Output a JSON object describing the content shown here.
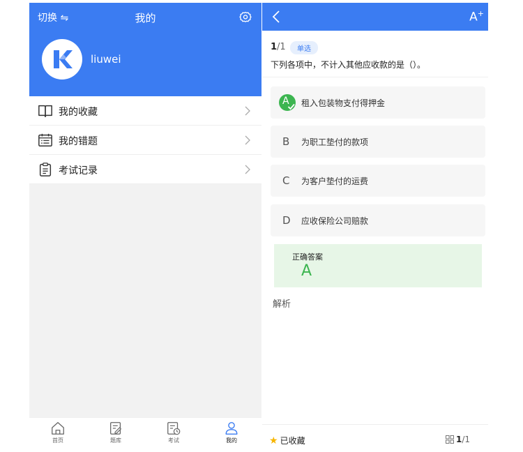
{
  "left": {
    "header": {
      "switch_label": "切换 ⇋",
      "title": "我的",
      "username": "liuwei"
    },
    "menu": [
      {
        "label": "我的收藏",
        "icon": "book-icon"
      },
      {
        "label": "我的错题",
        "icon": "calendar-list-icon"
      },
      {
        "label": "考试记录",
        "icon": "clipboard-icon"
      }
    ],
    "tabs": [
      {
        "label": "首页",
        "icon": "home-icon"
      },
      {
        "label": "题库",
        "icon": "edit-doc-icon"
      },
      {
        "label": "考试",
        "icon": "exam-clock-icon"
      },
      {
        "label": "我的",
        "icon": "user-icon",
        "active": true
      }
    ]
  },
  "right": {
    "header": {
      "font_size_button": "A"
    },
    "question": {
      "current": "1",
      "total": "/1",
      "type": "单选",
      "text": "下列各项中，不计入其他应收款的是（）。"
    },
    "options": [
      {
        "letter": "A",
        "text": "租入包装物支付得押金",
        "selected": true
      },
      {
        "letter": "B",
        "text": "为职工垫付的款项"
      },
      {
        "letter": "C",
        "text": "为客户垫付的运费"
      },
      {
        "letter": "D",
        "text": "应收保险公司赔款"
      }
    ],
    "answer": {
      "label": "正确答案",
      "value": "A"
    },
    "analysis_label": "解析",
    "footer": {
      "favorite_label": "已收藏",
      "page_current": "1",
      "page_total": "/1"
    }
  },
  "colors": {
    "primary": "#3b7cf2",
    "correct": "#3cb550",
    "answer_bg": "#e7f6e7",
    "star": "#f7b500"
  }
}
